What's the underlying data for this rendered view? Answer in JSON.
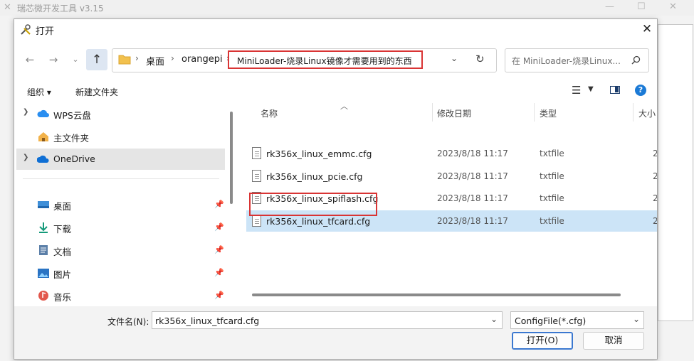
{
  "app": {
    "title": "瑞芯微开发工具 v3.15"
  },
  "dialog": {
    "title": "打开"
  },
  "address": {
    "crumbs": [
      "桌面",
      "orangepi",
      "MiniLoader-烧录Linux镜像才需要用到的东西"
    ]
  },
  "search": {
    "placeholder": "在 MiniLoader-烧录Linux..."
  },
  "toolbar": {
    "organize": "组织 ▾",
    "new_folder": "新建文件夹"
  },
  "sidebar": {
    "items": [
      {
        "label": "WPS云盘",
        "icon": "cloud-icon",
        "expandable": true,
        "selected": false
      },
      {
        "label": "主文件夹",
        "icon": "home-icon",
        "expandable": false,
        "selected": false
      },
      {
        "label": "OneDrive",
        "icon": "cloud-icon",
        "expandable": true,
        "selected": true
      },
      {
        "label": "桌面",
        "icon": "desktop-icon",
        "pinned": true
      },
      {
        "label": "下载",
        "icon": "download-icon",
        "pinned": true
      },
      {
        "label": "文档",
        "icon": "document-icon",
        "pinned": true
      },
      {
        "label": "图片",
        "icon": "picture-icon",
        "pinned": true
      },
      {
        "label": "音乐",
        "icon": "music-icon",
        "pinned": true
      }
    ]
  },
  "columns": {
    "name": "名称",
    "date": "修改日期",
    "type": "类型",
    "size": "大小"
  },
  "files": [
    {
      "name": "rk356x_linux_emmc.cfg",
      "date": "2023/8/18 11:17",
      "type": "txtfile",
      "size": "2"
    },
    {
      "name": "rk356x_linux_pcie.cfg",
      "date": "2023/8/18 11:17",
      "type": "txtfile",
      "size": "2"
    },
    {
      "name": "rk356x_linux_spiflash.cfg",
      "date": "2023/8/18 11:17",
      "type": "txtfile",
      "size": "2"
    },
    {
      "name": "rk356x_linux_tfcard.cfg",
      "date": "2023/8/18 11:17",
      "type": "txtfile",
      "size": "2",
      "selected": true
    }
  ],
  "footer": {
    "filename_label": "文件名(N):",
    "filename_value": "rk356x_linux_tfcard.cfg",
    "filter": "ConfigFile(*.cfg)",
    "open": "打开(O)",
    "cancel": "取消"
  },
  "colors": {
    "selection": "#cce4f7",
    "highlight_box": "#d93434",
    "accent": "#0067c0"
  }
}
